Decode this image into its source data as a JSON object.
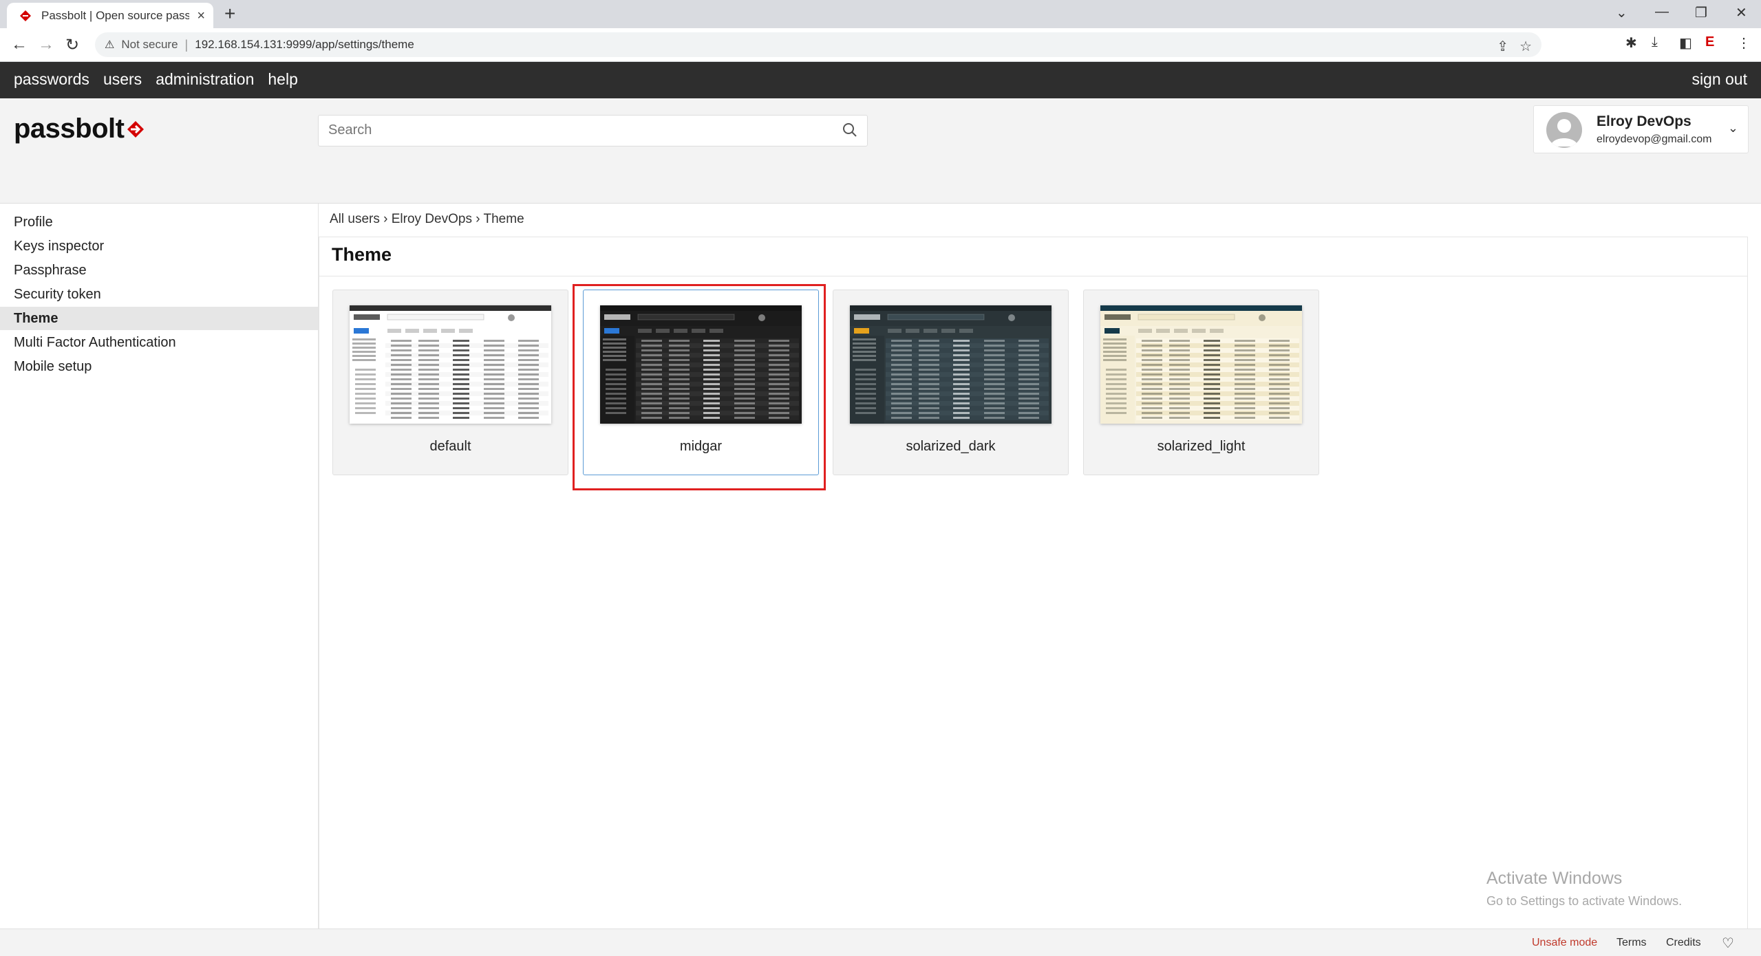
{
  "browser": {
    "tab_title": "Passbolt | Open source passwo",
    "security_label": "Not secure",
    "url": "192.168.154.131:9999/app/settings/theme"
  },
  "appnav": {
    "items": [
      "passwords",
      "users",
      "administration",
      "help"
    ],
    "signout": "sign out"
  },
  "header": {
    "logo_text": "passbolt",
    "search_placeholder": "Search",
    "user_name": "Elroy DevOps",
    "user_email": "elroydevop@gmail.com"
  },
  "sidebar": {
    "items": [
      {
        "label": "Profile",
        "active": false
      },
      {
        "label": "Keys inspector",
        "active": false
      },
      {
        "label": "Passphrase",
        "active": false
      },
      {
        "label": "Security token",
        "active": false
      },
      {
        "label": "Theme",
        "active": true
      },
      {
        "label": "Multi Factor Authentication",
        "active": false
      },
      {
        "label": "Mobile setup",
        "active": false
      }
    ]
  },
  "breadcrumb": {
    "items": [
      "All users",
      "Elroy DevOps",
      "Theme"
    ],
    "separator": "›"
  },
  "panel": {
    "title": "Theme"
  },
  "themes": [
    {
      "name": "default",
      "selected": false,
      "bg": "#ffffff",
      "nav": "#2e2e2e",
      "fg": "#333333",
      "accent": "#2b78d6",
      "row": "#ffffff",
      "row_alt": "#f6f6f6",
      "side": "#ffffff"
    },
    {
      "name": "midgar",
      "selected": true,
      "bg": "#1f1f1f",
      "nav": "#141414",
      "fg": "#dddddd",
      "accent": "#2b78d6",
      "row": "#262626",
      "row_alt": "#303030",
      "side": "#1b1b1b"
    },
    {
      "name": "solarized_dark",
      "selected": false,
      "bg": "#2f3a3e",
      "nav": "#1d2528",
      "fg": "#cfd6d8",
      "accent": "#e6a21c",
      "row": "#34434a",
      "row_alt": "#3b4b52",
      "side": "#2a3438"
    },
    {
      "name": "solarized_light",
      "selected": false,
      "bg": "#f7f1dd",
      "nav": "#153a4a",
      "fg": "#4a4a3a",
      "accent": "#153a4a",
      "row": "#fbf6e6",
      "row_alt": "#f0e7c8",
      "side": "#f5eed6"
    }
  ],
  "windows_watermark": {
    "line1": "Activate Windows",
    "line2": "Go to Settings to activate Windows."
  },
  "footer": {
    "unsafe": "Unsafe mode",
    "terms": "Terms",
    "credits": "Credits"
  },
  "colors": {
    "unsafe": "#c0392b",
    "highlight_box": "#e02020",
    "selected_border": "#5b9bd5"
  }
}
